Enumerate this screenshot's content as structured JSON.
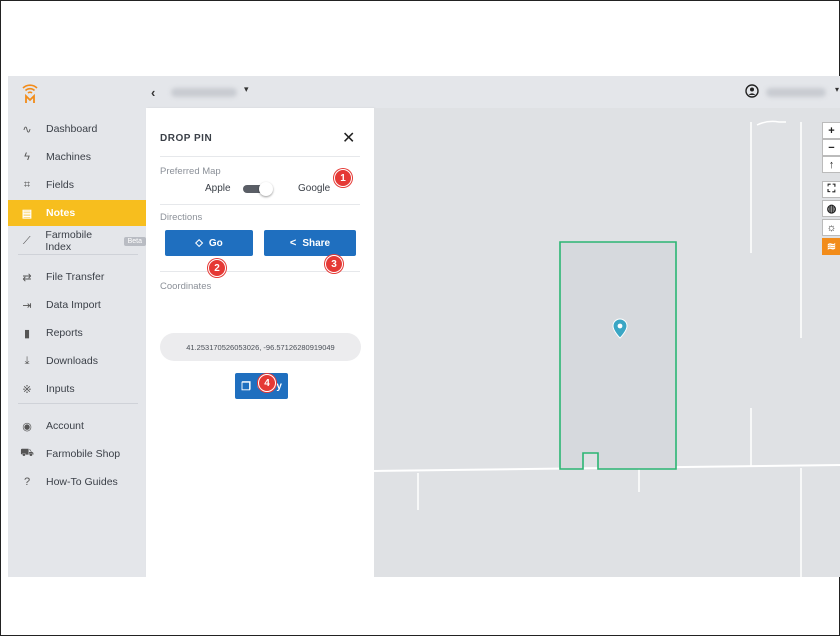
{
  "topbar": {
    "back_icon": "chevron-left-icon",
    "farm_caret": "▾",
    "user_caret": "▾"
  },
  "sidebar": {
    "items": [
      {
        "label": "Dashboard",
        "icon": "activity-icon",
        "glyph": "∿"
      },
      {
        "label": "Machines",
        "icon": "lightning-icon",
        "glyph": "ϟ"
      },
      {
        "label": "Fields",
        "icon": "field-frame-icon",
        "glyph": "⌗"
      },
      {
        "label": "Notes",
        "icon": "note-icon",
        "glyph": "▤",
        "active": true
      },
      {
        "label": "Farmobile Index",
        "icon": "trend-icon",
        "glyph": "⟋",
        "badge": "Beta"
      },
      {
        "label": "File Transfer",
        "icon": "transfer-icon",
        "glyph": "⇄"
      },
      {
        "label": "Data Import",
        "icon": "import-icon",
        "glyph": "⇥"
      },
      {
        "label": "Reports",
        "icon": "bar-chart-icon",
        "glyph": "▮"
      },
      {
        "label": "Downloads",
        "icon": "download-icon",
        "glyph": "⤓"
      },
      {
        "label": "Inputs",
        "icon": "inputs-icon",
        "glyph": "※"
      },
      {
        "label": "Account",
        "icon": "account-icon",
        "glyph": "◉"
      },
      {
        "label": "Farmobile Shop",
        "icon": "cart-icon",
        "glyph": "⛟"
      },
      {
        "label": "How-To Guides",
        "icon": "help-icon",
        "glyph": "?"
      }
    ]
  },
  "panel": {
    "title": "DROP PIN",
    "close_glyph": "✕",
    "preferred_map_label": "Preferred Map",
    "apple_label": "Apple",
    "google_label": "Google",
    "toggle_state": "Google",
    "directions_label": "Directions",
    "go_label": "Go",
    "share_label": "Share",
    "coordinates_label": "Coordinates",
    "coordinates_value": "41.253170526053026, -96.57126280919049",
    "copy_label": "Copy"
  },
  "map_controls": [
    {
      "icon": "zoom-in-icon",
      "glyph": "+"
    },
    {
      "icon": "zoom-out-icon",
      "glyph": "−"
    },
    {
      "icon": "compass-icon",
      "glyph": "↑"
    },
    {
      "icon": "fullscreen-icon",
      "glyph": "⛶"
    },
    {
      "icon": "globe-icon",
      "glyph": "◍"
    },
    {
      "icon": "weather-icon",
      "glyph": "☼"
    },
    {
      "icon": "layers-icon",
      "glyph": "≋"
    }
  ],
  "callouts": [
    "1",
    "2",
    "3",
    "4"
  ],
  "colors": {
    "accent": "#f7be1e",
    "button": "#1f6fbf",
    "field_outline": "#2bb673",
    "pin": "#3aa6c4",
    "callout": "#e53935",
    "layers_button": "#f28c1a"
  }
}
